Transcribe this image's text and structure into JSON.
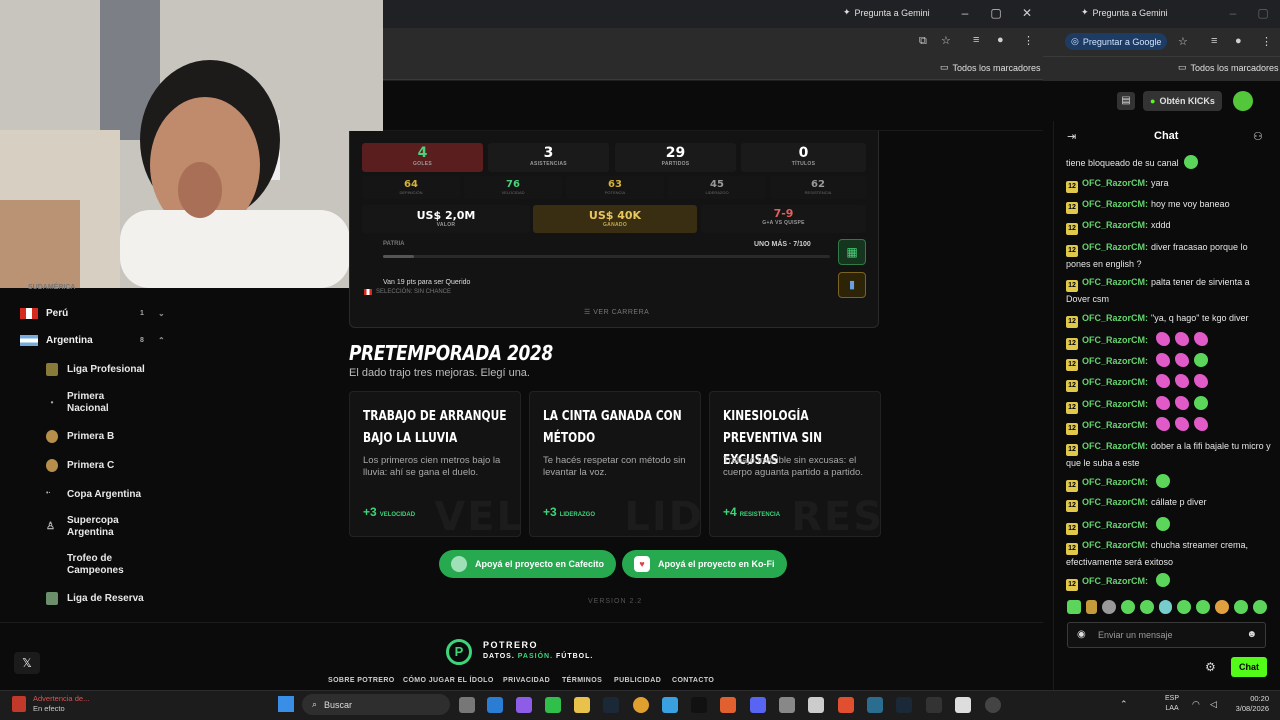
{
  "browser": {
    "ask_gemini": "Pregunta a Gemini",
    "bookmarks_all": "Todos los marcadores",
    "ask_google": "Preguntar a Google"
  },
  "kick": {
    "get_kicks": "Obtén KICKs",
    "chat_title": "Chat"
  },
  "sidebar": {
    "top_truncated": "SUDAMÉRICA",
    "countries": [
      {
        "name": "Perú",
        "count": "1"
      },
      {
        "name": "Argentina",
        "count": "8"
      }
    ],
    "leagues": [
      "Liga Profesional",
      "Primera Nacional",
      "Primera B",
      "Primera C",
      "Copa Argentina",
      "Supercopa Argentina",
      "Trofeo de Campeones",
      "Liga de Reserva"
    ]
  },
  "stats": {
    "main": [
      {
        "value": "4",
        "label": "GOLES",
        "color": "#7a1f1f"
      },
      {
        "value": "3",
        "label": "ASISTENCIAS",
        "color": "#1c1c1c"
      },
      {
        "value": "29",
        "label": "PARTIDOS",
        "color": "#1c1c1c"
      },
      {
        "value": "0",
        "label": "TÍTULOS",
        "color": "#1c1c1c"
      }
    ],
    "attrs": [
      {
        "value": "64",
        "label": "DEFINICIÓN",
        "color": "#d6b23a"
      },
      {
        "value": "76",
        "label": "VELOCIDAD",
        "color": "#4bd27b"
      },
      {
        "value": "63",
        "label": "POTENCIA",
        "color": "#d6b23a"
      },
      {
        "value": "45",
        "label": "LIDERAZGO",
        "color": "#9a9a9a"
      },
      {
        "value": "62",
        "label": "RESISTENCIA",
        "color": "#9a9a9a"
      }
    ],
    "value_box": {
      "value": "US$ 2,0M",
      "label": "VALOR"
    },
    "earned_box": {
      "value": "US$ 40K",
      "label": "GANADO"
    },
    "match_box": {
      "value": "7-9",
      "label": "G+A VS QUISPE"
    },
    "patria_label": "PATRIA",
    "one_more": "UNO MÁS · 7/100",
    "querido_text": "Van 19 pts para ser Querido",
    "seleccion": "SELECCIÓN: SIN CHANCE",
    "ver_carrera": "VER CARRERA"
  },
  "preseason": {
    "title": "PRETEMPORADA 2028",
    "subtitle": "El dado trajo tres mejoras. Elegí una.",
    "cards": [
      {
        "title": "Trabajo de arranque bajo la lluvia",
        "desc": "Los primeros cien metros bajo la lluvia: ahí se gana el duelo.",
        "bonus": "+3",
        "stat": "VELOCIDAD",
        "wm": "VEL"
      },
      {
        "title": "La cinta ganada con método",
        "desc": "Te hacés respetar con método sin levantar la voz.",
        "bonus": "+3",
        "stat": "LIDERAZGO",
        "wm": "LID"
      },
      {
        "title": "Kinesiología preventiva sin excusas",
        "desc": "Trabajo invisible sin excusas: el cuerpo aguanta partido a partido.",
        "bonus": "+4",
        "stat": "RESISTENCIA",
        "wm": "RES"
      }
    ]
  },
  "support": {
    "cafecito": "Apoyá el proyecto en Cafecito",
    "kofi": "Apoyá el proyecto en Ko-Fi"
  },
  "version": "VERSION 2.2",
  "footer": {
    "brand": "POTRERO",
    "tagline_a": "DATOS.",
    "tagline_b": "PASIÓN.",
    "tagline_c": "FÚTBOL.",
    "links": [
      "SOBRE POTRERO",
      "CÓMO JUGAR EL ÍDOLO",
      "PRIVACIDAD",
      "TÉRMINOS",
      "PUBLICIDAD",
      "CONTACTO"
    ]
  },
  "chat": {
    "first_line": "tiene bloqueado de su canal",
    "user": "OFC_RazorCM:",
    "badge": "12",
    "messages": [
      "yara",
      "hoy me voy baneao",
      "xddd",
      "diver fracasao porque lo pones en english ?",
      "palta tener de sirvienta a Dover csm",
      "\"ya, q hago\" te kgo diver",
      "",
      "",
      "",
      "",
      "",
      "dober a la fifi bajale tu micro y que le suba a este",
      "",
      "cállate p diver",
      "",
      "chucha streamer crema, efectivamente será exitoso",
      ""
    ],
    "input_placeholder": "Enviar un mensaje",
    "send_label": "Chat"
  },
  "taskbar": {
    "warning_title": "Advertencia de...",
    "warning_sub": "En efecto",
    "search": "Buscar",
    "lang_a": "ESP",
    "lang_b": "LAA",
    "time": "00:20",
    "date": "3/08/2026"
  }
}
